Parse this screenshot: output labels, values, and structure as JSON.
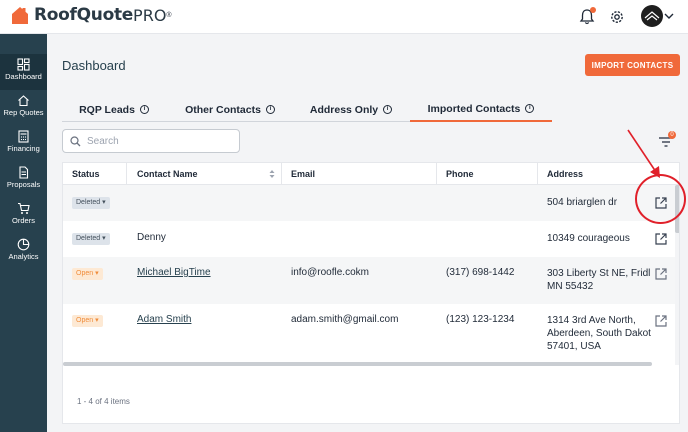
{
  "brand": {
    "name": "RoofQuote",
    "suffix": "PRO",
    "reg": "®",
    "logo_color": "#f0693a"
  },
  "header": {
    "notifications_icon": "bell-icon",
    "settings_icon": "gear-icon",
    "menu_icon": "chevron-down-icon"
  },
  "sidebar": {
    "items": [
      {
        "label": "Dashboard",
        "icon": "dashboard-icon",
        "active": true
      },
      {
        "label": "Rep Quotes",
        "icon": "house-icon"
      },
      {
        "label": "Financing",
        "icon": "calculator-icon"
      },
      {
        "label": "Proposals",
        "icon": "document-icon"
      },
      {
        "label": "Orders",
        "icon": "cart-icon"
      },
      {
        "label": "Analytics",
        "icon": "pie-chart-icon"
      }
    ]
  },
  "page": {
    "title": "Dashboard",
    "import_label": "IMPORT CONTACTS"
  },
  "tabs": [
    {
      "label": "RQP Leads"
    },
    {
      "label": "Other Contacts"
    },
    {
      "label": "Address Only"
    },
    {
      "label": "Imported Contacts",
      "active": true
    }
  ],
  "tab_info_glyph": "i",
  "search": {
    "placeholder": "Search"
  },
  "filter": {
    "badge": "0"
  },
  "table": {
    "columns": [
      "Status",
      "Contact Name",
      "Email",
      "Phone",
      "Address"
    ],
    "rows": [
      {
        "status": "Deleted",
        "name": "",
        "email": "",
        "phone": "",
        "address": "504 briarglen dr"
      },
      {
        "status": "Deleted",
        "name": "Denny",
        "email": "",
        "phone": "",
        "address": "10349 courageous"
      },
      {
        "status": "Open",
        "name": "Michael BigTime",
        "email": "info@roofle.cokm",
        "phone": "(317) 698-1442",
        "address": "303 Liberty St NE, Fridl\nMN 55432"
      },
      {
        "status": "Open",
        "name": "Adam Smith",
        "email": "adam.smith@gmail.com",
        "phone": "(123) 123-1234",
        "address": "1314 3rd Ave North,\nAberdeen, South Dakot\n57401, USA"
      }
    ],
    "pagination": "1 - 4 of 4 items"
  },
  "colors": {
    "accent": "#f0693a",
    "sidebar": "#27414e",
    "annotation": "#e0202a"
  }
}
